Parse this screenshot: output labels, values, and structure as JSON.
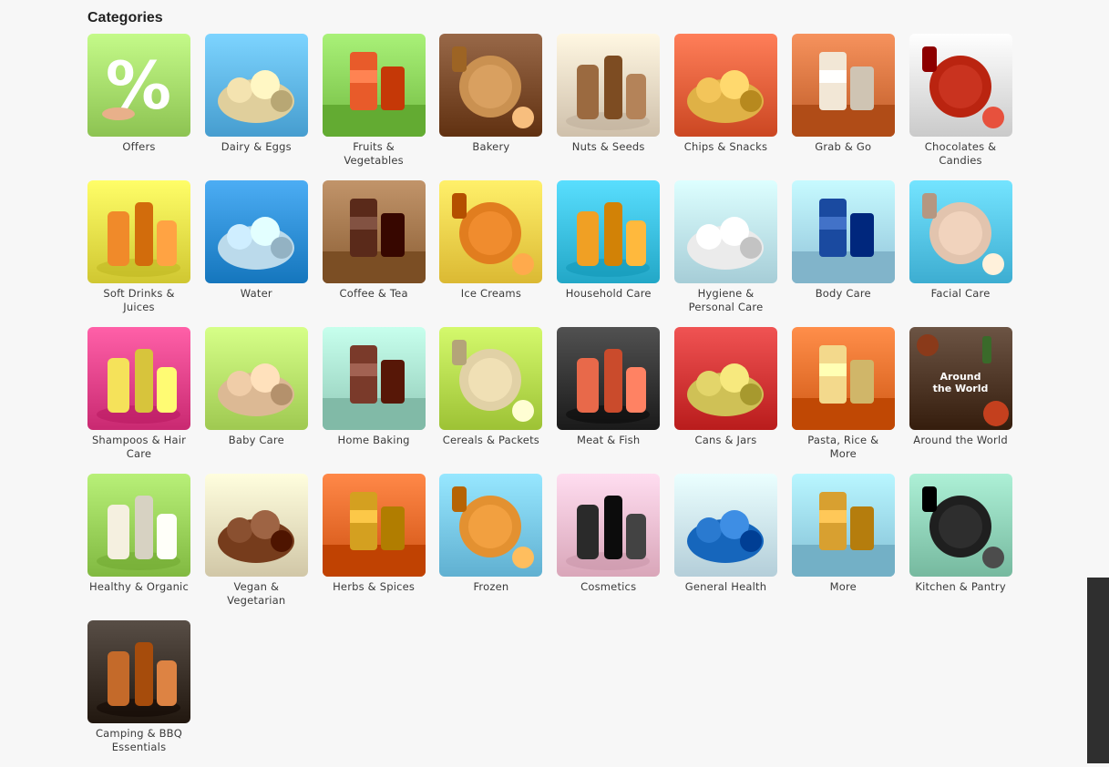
{
  "section_title": "Categories",
  "categories": [
    {
      "label": "Offers",
      "icon": "percent-offer-icon",
      "bg": "#a6dc6b",
      "fg": "#ffffff"
    },
    {
      "label": "Dairy & Eggs",
      "icon": "milk-cheese-icon",
      "bg": "#5fb6e8",
      "fg": "#f4e3b0"
    },
    {
      "label": "Fruits & Vegetables",
      "icon": "fruit-basket-icon",
      "bg": "#8bd35a",
      "fg": "#e85b2a"
    },
    {
      "label": "Bakery",
      "icon": "bread-icon",
      "bg": "#7a4a2a",
      "fg": "#d9a060"
    },
    {
      "label": "Nuts & Seeds",
      "icon": "nuts-bowl-icon",
      "bg": "#e8d9c4",
      "fg": "#9b6a40"
    },
    {
      "label": "Chips & Snacks",
      "icon": "chips-icon",
      "bg": "#e4603b",
      "fg": "#f3c55a"
    },
    {
      "label": "Grab & Go",
      "icon": "sandwich-coffee-icon",
      "bg": "#d8743f",
      "fg": "#f2e7d6"
    },
    {
      "label": "Chocolates & Candies",
      "icon": "candy-pack-icon",
      "bg": "#e3e3e3",
      "fg": "#c9331f"
    },
    {
      "label": "Soft Drinks & Juices",
      "icon": "juice-glasses-icon",
      "bg": "#e9e04a",
      "fg": "#f08a2a"
    },
    {
      "label": "Water",
      "icon": "water-glass-icon",
      "bg": "#2e8fd6",
      "fg": "#cfeeff"
    },
    {
      "label": "Coffee & Tea",
      "icon": "coffee-jar-icon",
      "bg": "#a3764c",
      "fg": "#5a2a1a"
    },
    {
      "label": "Ice Creams",
      "icon": "popsicle-icon",
      "bg": "#f4d24c",
      "fg": "#f08c2e"
    },
    {
      "label": "Household Care",
      "icon": "cleaning-bottles-icon",
      "bg": "#3bc0e0",
      "fg": "#f0a024"
    },
    {
      "label": "Hygiene & Personal Care",
      "icon": "toothpaste-icon",
      "bg": "#bfe6f0",
      "fg": "#ffffff"
    },
    {
      "label": "Body Care",
      "icon": "lotion-bottle-icon",
      "bg": "#a9dcf2",
      "fg": "#1a4aa0"
    },
    {
      "label": "Facial Care",
      "icon": "face-care-icon",
      "bg": "#56c6ea",
      "fg": "#f1d3bd"
    },
    {
      "label": "Shampoos & Hair Care",
      "icon": "shampoo-bottles-icon",
      "bg": "#e2428a",
      "fg": "#f5e25a"
    },
    {
      "label": "Baby Care",
      "icon": "baby-icon",
      "bg": "#b8e26a",
      "fg": "#f0cda8"
    },
    {
      "label": "Home Baking",
      "icon": "whisk-cake-icon",
      "bg": "#a9e2cf",
      "fg": "#7a3a2a"
    },
    {
      "label": "Cereals & Packets",
      "icon": "cereal-bowl-icon",
      "bg": "#b6db4e",
      "fg": "#f0e0b5"
    },
    {
      "label": "Meat & Fish",
      "icon": "meat-fish-icon",
      "bg": "#333333",
      "fg": "#e8694a"
    },
    {
      "label": "Cans & Jars",
      "icon": "jars-icon",
      "bg": "#d23535",
      "fg": "#e3d56a"
    },
    {
      "label": "Pasta, Rice & More",
      "icon": "pasta-icon",
      "bg": "#e8702c",
      "fg": "#f3d98c"
    },
    {
      "label": "Around the World",
      "icon": "world-foods-icon",
      "bg": "#4e3626",
      "fg": "#ffffff"
    },
    {
      "label": "Healthy & Organic",
      "icon": "organic-icon",
      "bg": "#9ad25a",
      "fg": "#f5f0e0"
    },
    {
      "label": "Vegan & Vegetarian",
      "icon": "vegan-sausage-icon",
      "bg": "#eae0c0",
      "fg": "#8a5030"
    },
    {
      "label": "Herbs & Spices",
      "icon": "spices-icon",
      "bg": "#e86a2a",
      "fg": "#d4a020"
    },
    {
      "label": "Frozen",
      "icon": "frozen-veg-icon",
      "bg": "#79c9ea",
      "fg": "#f2a040"
    },
    {
      "label": "Cosmetics",
      "icon": "makeup-icon",
      "bg": "#f2bfd2",
      "fg": "#2a2a2a"
    },
    {
      "label": "General Health",
      "icon": "medicine-icon",
      "bg": "#cde7f2",
      "fg": "#2a7ad0"
    },
    {
      "label": "More",
      "icon": "gift-bag-icon",
      "bg": "#9bd8ee",
      "fg": "#d8a030"
    },
    {
      "label": "Kitchen & Pantry",
      "icon": "cookware-icon",
      "bg": "#8fd2b8",
      "fg": "#2e2e2e"
    },
    {
      "label": "Camping & BBQ Essentials",
      "icon": "bbq-grill-icon",
      "bg": "#3a3028",
      "fg": "#c46a2a"
    }
  ],
  "overlay_text": {
    "offers_symbol": "%",
    "around_world_line1": "Around",
    "around_world_line2": "the World"
  }
}
